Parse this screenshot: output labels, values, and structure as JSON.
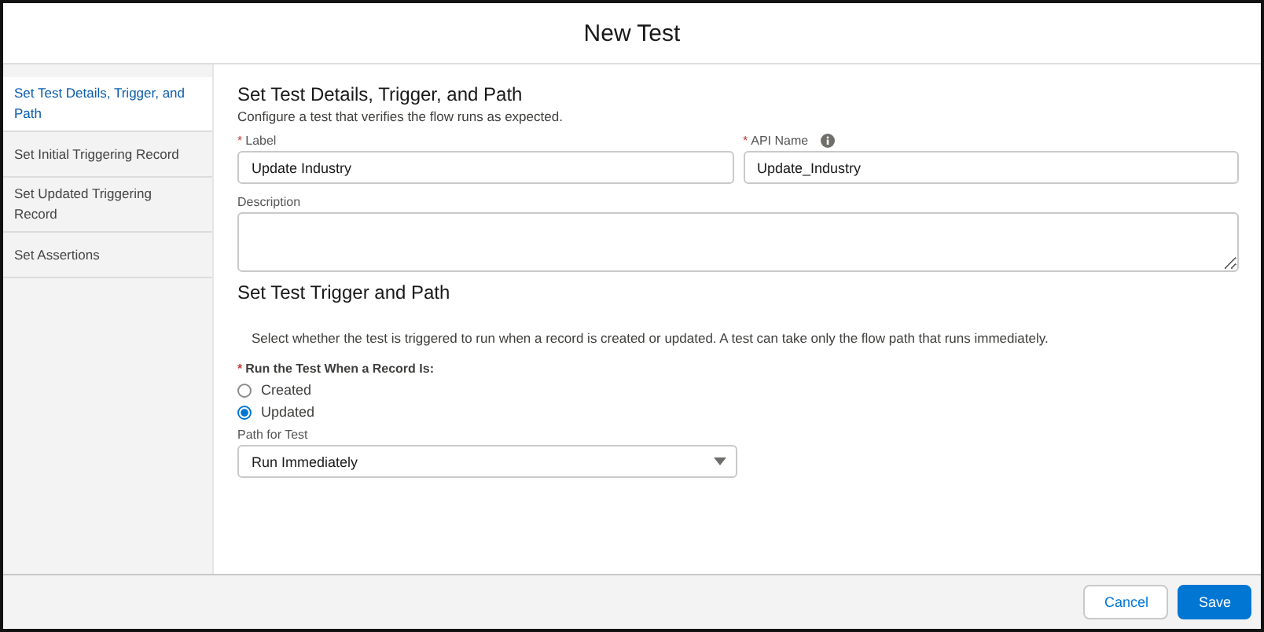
{
  "modal": {
    "title": "New Test"
  },
  "sidebar": {
    "items": [
      {
        "label": "Set Test Details, Trigger, and Path",
        "selected": true
      },
      {
        "label": "Set Initial Triggering Record",
        "selected": false
      },
      {
        "label": "Set Updated Triggering Record",
        "selected": false
      },
      {
        "label": "Set Assertions",
        "selected": false
      }
    ]
  },
  "details": {
    "title": "Set Test Details, Trigger, and Path",
    "subtitle": "Configure a test that verifies the flow runs as expected.",
    "label_field": {
      "label": "Label",
      "required_mark": "*",
      "value": "Update Industry"
    },
    "api_name_field": {
      "label": "API Name",
      "required_mark": "*",
      "value": "Update_Industry"
    },
    "description_field": {
      "label": "Description"
    }
  },
  "trigger": {
    "title": "Set Test Trigger and Path",
    "instructions": "Select whether the test is triggered to run when a record is created or updated. A test can take only the flow path that runs immediately.",
    "radio_group": {
      "label": "Run the Test When a Record Is:",
      "required_mark": "*",
      "options": [
        {
          "label": "Created",
          "selected": false
        },
        {
          "label": "Updated",
          "selected": true
        }
      ]
    },
    "path_select": {
      "label": "Path for Test",
      "value": "Run Immediately"
    }
  },
  "footer": {
    "buttons": [
      {
        "label": "Cancel",
        "kind": "neutral"
      },
      {
        "label": "Save",
        "kind": "brand"
      }
    ]
  }
}
